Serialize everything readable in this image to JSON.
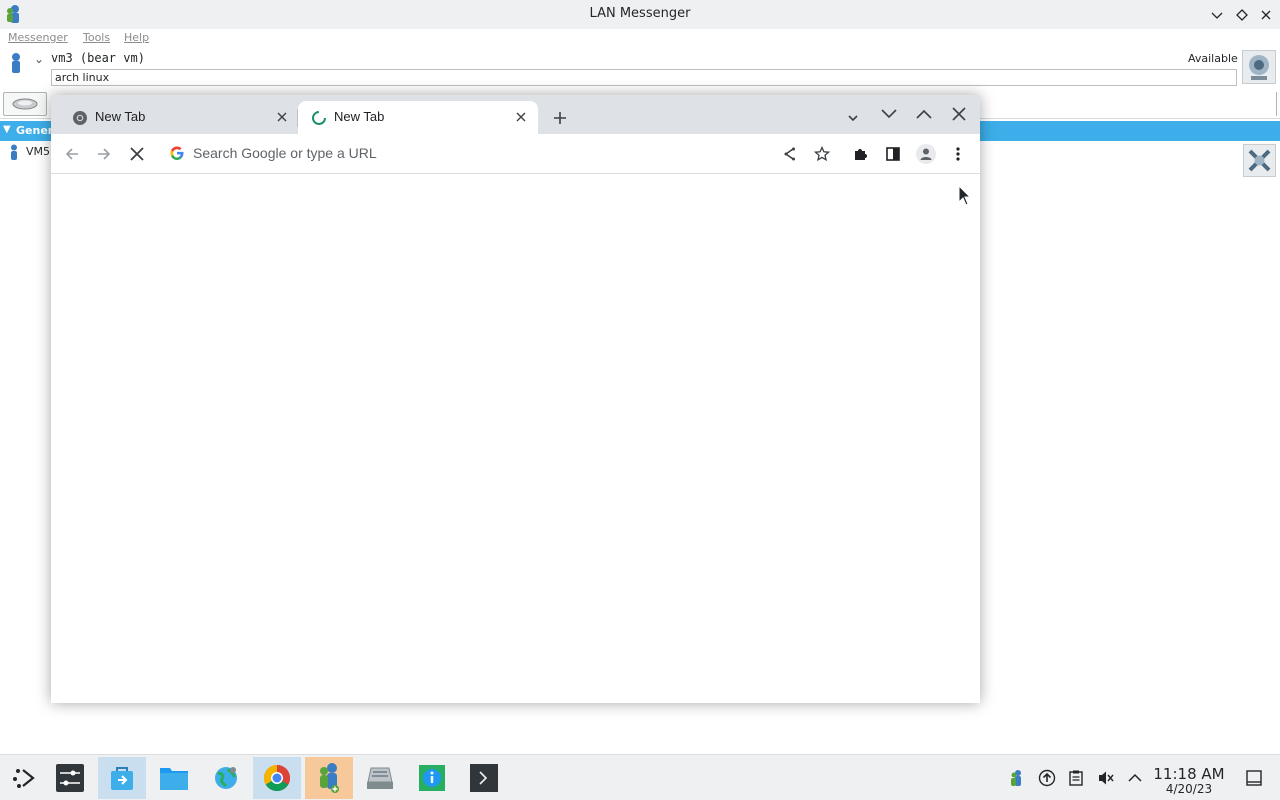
{
  "lan_messenger": {
    "title": "LAN Messenger",
    "menu": [
      "Messenger",
      "Tools",
      "Help"
    ],
    "user_name": "vm3 (bear vm)",
    "status": "Available",
    "status_note": "arch linux",
    "group_name": "General",
    "group_name_visible": "Gener",
    "contact_name_visible": "VM5"
  },
  "chrome": {
    "tabs": [
      {
        "title": "New Tab",
        "active": false
      },
      {
        "title": "New Tab",
        "active": true
      }
    ],
    "omnibox_placeholder": "Search Google or type a URL"
  },
  "taskbar": {
    "apps": [
      "application-launcher",
      "system-settings",
      "discover",
      "file-manager",
      "web-browser",
      "google-chrome",
      "lan-messenger",
      "scanner",
      "system-info",
      "terminal"
    ],
    "clock_time": "11:18 AM",
    "clock_date": "4/20/23"
  },
  "colors": {
    "selection_blue": "#3daee9",
    "chrome_tabstrip": "#dee1e6",
    "taskbar_bg": "#eff0f1"
  }
}
